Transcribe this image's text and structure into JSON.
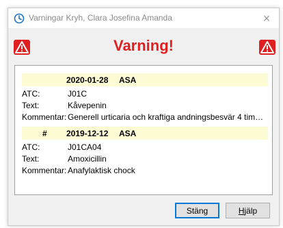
{
  "window": {
    "title": "Varningar  Kryh, Clara Josefina Amanda",
    "close_glyph": "×"
  },
  "heading": "Varning!",
  "colors": {
    "heading": "#e02020",
    "warning_icon_bg": "#e02020",
    "entry_header_bg": "#fdfbd4",
    "app_icon": "#1a73c8"
  },
  "entries": [
    {
      "marker": "",
      "date": "2020-01-28",
      "type": "ASA",
      "atc_label": "ATC:",
      "atc": "J01C",
      "text_label": "Text:",
      "text": "Kåvepenin",
      "comment_label": "Kommentar:",
      "comment": "Generell urticaria och kraftiga andningsbesvär 4 timm..."
    },
    {
      "marker": "#",
      "date": "2019-12-12",
      "type": "ASA",
      "atc_label": "ATC:",
      "atc": "J01CA04",
      "text_label": "Text:",
      "text": "Amoxicillin",
      "comment_label": "Kommentar:",
      "comment": "Anafylaktisk chock"
    }
  ],
  "buttons": {
    "close_label": "Stäng",
    "help_label_mnemonic": "H",
    "help_label_rest": "jälp"
  },
  "icons": {
    "app": "timer-icon",
    "warning": "warning-icon",
    "close": "close-icon"
  }
}
